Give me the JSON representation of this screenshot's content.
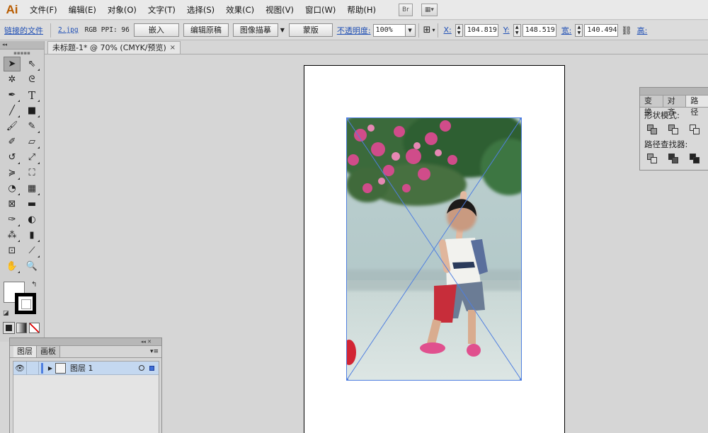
{
  "app": {
    "logo": "Ai"
  },
  "menu": {
    "items": [
      "文件(F)",
      "编辑(E)",
      "对象(O)",
      "文字(T)",
      "选择(S)",
      "效果(C)",
      "视图(V)",
      "窗口(W)",
      "帮助(H)"
    ],
    "bridge_label": "Br",
    "arrange_label": "▦▾"
  },
  "control": {
    "linked_file": "链接的文件",
    "file_name": "2.jpg",
    "color_mode": "RGB",
    "ppi": "PPI: 96",
    "embed": "嵌入",
    "edit_original": "编辑原稿",
    "image_trace": "图像描摹",
    "mask": "蒙版",
    "opacity_label": "不透明度:",
    "opacity_value": "100%",
    "x_label": "X:",
    "x_value": "104.819",
    "y_label": "Y:",
    "y_value": "148.519",
    "w_label": "宽:",
    "w_value": "140.494",
    "h_label": "高:"
  },
  "document": {
    "tab_title": "未标题-1* @ 70% (CMYK/预览)",
    "close": "×"
  },
  "pathfinder": {
    "tabs": [
      "变换",
      "对齐",
      "路径"
    ],
    "shape_modes": "形状模式:",
    "pathfinders": "路径查找器:"
  },
  "layers": {
    "tabs": [
      "图层",
      "画板"
    ],
    "rows": [
      {
        "name": "图层 1"
      }
    ]
  },
  "colors": {
    "accent": "#1f4fb5",
    "selection": "#4f7fe0",
    "layer_row": "#c4d8f0"
  }
}
